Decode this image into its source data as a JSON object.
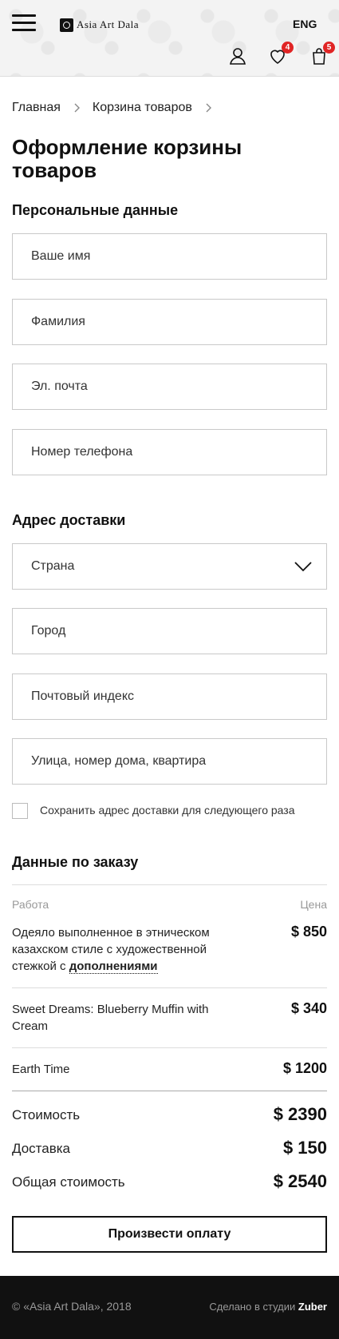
{
  "header": {
    "logo_text": "Asia Art Dala",
    "lang": "ENG",
    "wishlist_count": "4",
    "cart_count": "5"
  },
  "breadcrumb": {
    "home": "Главная",
    "cart": "Корзина товаров"
  },
  "page_title": "Оформление корзины товаров",
  "personal": {
    "title": "Персональные данные",
    "first_name_placeholder": "Ваше имя",
    "last_name_placeholder": "Фамилия",
    "email_placeholder": "Эл. почта",
    "phone_placeholder": "Номер телефона"
  },
  "delivery": {
    "title": "Адрес доставки",
    "country_selected": "Страна",
    "city_placeholder": "Город",
    "zip_placeholder": "Почтовый индекс",
    "street_placeholder": "Улица, номер дома, квартира",
    "save_label": "Сохранить адрес доставки для следующего раза"
  },
  "order": {
    "title": "Данные по заказу",
    "col_work": "Работа",
    "col_price": "Цена",
    "items": [
      {
        "name": "Одеяло выполненное в этническом казахском стиле с художественной стежкой с",
        "link": "дополнениями",
        "price": "$ 850"
      },
      {
        "name": "Sweet Dreams: Blueberry Muffin with Cream",
        "price": "$ 340"
      },
      {
        "name": "Earth Time",
        "price": "$ 1200"
      }
    ],
    "cost_label": "Стоимость",
    "cost_value": "$ 2390",
    "shipping_label": "Доставка",
    "shipping_value": "$ 150",
    "total_label": "Общая стоимость",
    "total_value": "$ 2540",
    "pay_button": "Произвести оплату"
  },
  "footer": {
    "copyright": "© «Asia Art Dala», 2018",
    "studio_prefix": "Сделано в студии",
    "studio_name": "Zuber"
  },
  "colors": {
    "badge": "#e02424",
    "footer_bg": "#111111",
    "border": "#c9c9c9"
  }
}
